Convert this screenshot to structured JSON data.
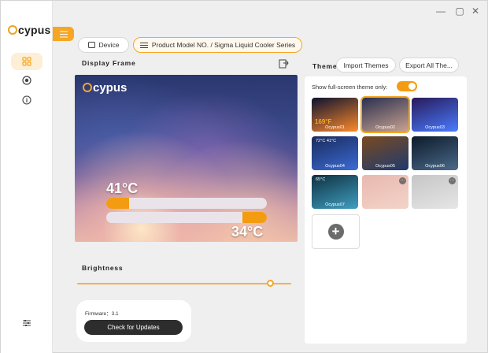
{
  "app": {
    "logo_text": "cypus",
    "window_controls": [
      "minimize",
      "maximize",
      "close"
    ]
  },
  "sidebar": {
    "items": [
      {
        "icon": "grid-icon",
        "active": true
      },
      {
        "icon": "radar-icon",
        "active": false
      },
      {
        "icon": "info-icon",
        "active": false
      }
    ],
    "settings_icon": "sliders-icon"
  },
  "tabs": {
    "device": "Device",
    "model": "Product Model NO. / Sigma Liquid Cooler Series"
  },
  "display_frame": {
    "title": "Display Frame",
    "logo_text": "cypus",
    "cpu_temp": "41°C",
    "gpu_temp": "34°C",
    "cpu_bar_fill": 0.14,
    "gpu_bar_fill": 0.15
  },
  "brightness": {
    "label": "Brightness",
    "value": 0.9
  },
  "firmware": {
    "label": "Firmware：3.1",
    "button": "Check for Updates"
  },
  "theme": {
    "title": "Theme",
    "import_button": "Import Themes",
    "export_button": "Export All The...",
    "fullscreen_label": "Show full-screen theme only:",
    "fullscreen_on": true,
    "thumbnails": [
      {
        "label": "Ocypus01",
        "temp": "169°F",
        "selected": false,
        "colors": [
          "#0b1230",
          "#ff8a2b"
        ]
      },
      {
        "label": "Ocypus02",
        "selected": true,
        "colors": [
          "#2a2f50",
          "#c9a38f"
        ]
      },
      {
        "label": "Ocypus03",
        "selected": false,
        "colors": [
          "#281a5a",
          "#4a7cff"
        ]
      },
      {
        "label": "Ocypus04",
        "temp": "72°C  41°C",
        "selected": false,
        "colors": [
          "#1b2a5a",
          "#3a6bd6"
        ]
      },
      {
        "label": "Ocypus05",
        "selected": false,
        "colors": [
          "#7a4a20",
          "#1e3a6e"
        ]
      },
      {
        "label": "Ocypus06",
        "selected": false,
        "colors": [
          "#0d1a2a",
          "#4a6a8a"
        ]
      },
      {
        "label": "",
        "selected": false,
        "more": true,
        "colors": [
          "#e9c48a",
          "#4a7ab8"
        ]
      },
      {
        "label": "Ocypus07",
        "temp": "65°C",
        "selected": false,
        "colors": [
          "#0f3040",
          "#3f9fc2"
        ]
      },
      {
        "label": "",
        "selected": false,
        "more": true,
        "colors": [
          "#e8b8b0",
          "#f3d4c8"
        ]
      },
      {
        "label": "",
        "selected": false,
        "more": true,
        "colors": [
          "#c6c6c6",
          "#e6e6e6"
        ]
      }
    ],
    "add_label": "+"
  }
}
